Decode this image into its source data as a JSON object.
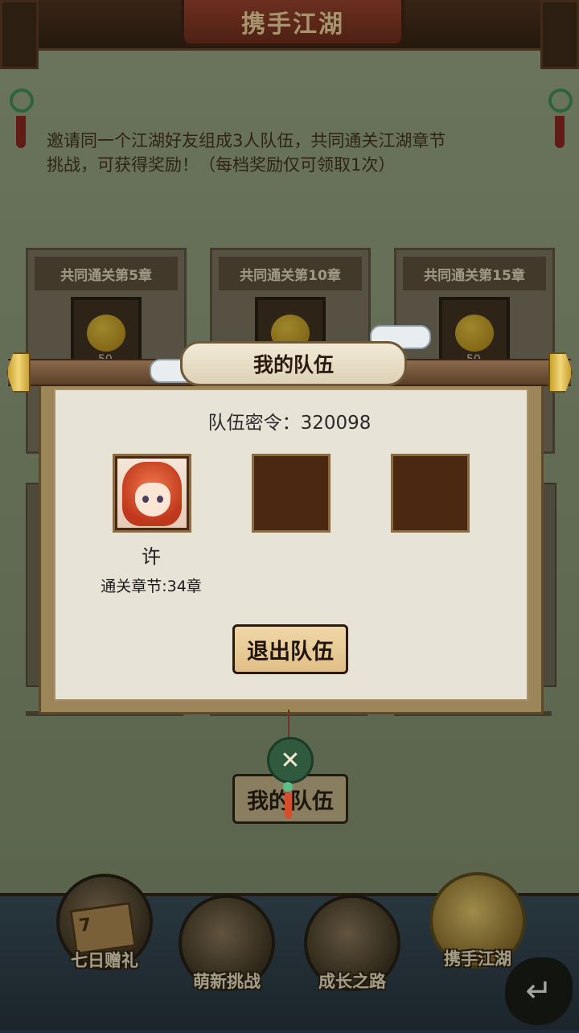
{
  "header": {
    "title": "携手江湖"
  },
  "intro": {
    "line1": "邀请同一个江湖好友组成3人队伍，共同通关江湖章节",
    "line2": "挑战，可获得奖励！（每档奖励仅可领取1次）"
  },
  "rewards": [
    {
      "label": "共同通关第5章",
      "quantity": "50",
      "icon": "gourd-icon"
    },
    {
      "label": "共同通关第10章",
      "quantity": "50",
      "icon": "gourd-icon"
    },
    {
      "label": "共同通关第15章",
      "quantity": "50",
      "icon": "gourd-icon"
    }
  ],
  "background_button": {
    "label": "我的队伍"
  },
  "modal": {
    "title": "我的队伍",
    "password_label": "队伍密令：",
    "password_value": "320098",
    "members": [
      {
        "name": "许",
        "chapter": "通关章节:34章",
        "filled": true
      },
      {
        "filled": false
      },
      {
        "filled": false
      }
    ],
    "leave_button": "退出队伍",
    "close_icon": "crossed-swords-close-icon"
  },
  "bottom_nav": [
    {
      "label": "七日赠礼",
      "icon": "seven-day-gift-icon",
      "badge": "7",
      "active": false
    },
    {
      "label": "萌新挑战",
      "icon": "newbie-challenge-icon",
      "active": false
    },
    {
      "label": "成长之路",
      "icon": "growth-path-icon",
      "active": false
    },
    {
      "label": "携手江湖",
      "icon": "handshake-icon",
      "active": true
    }
  ],
  "back_icon": "return-arrow-icon",
  "colors": {
    "panel_bg": "#e7e3d6",
    "button_bg": "#e0bf86",
    "slot_bg": "#4a2812",
    "title_red": "#9b3c2a"
  }
}
